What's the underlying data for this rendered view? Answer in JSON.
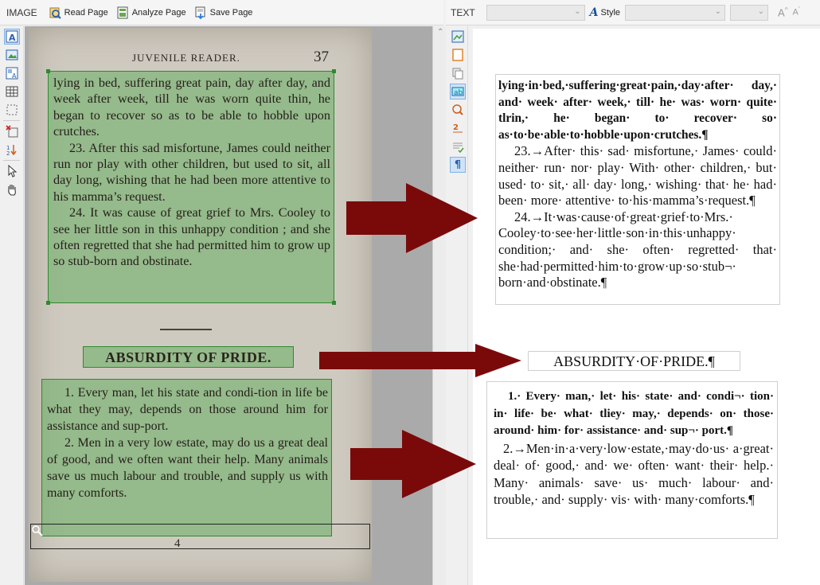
{
  "left_toolbar": {
    "pane_label": "IMAGE",
    "read_page": "Read Page",
    "analyze_page": "Analyze Page",
    "save_page": "Save Page"
  },
  "right_toolbar": {
    "pane_label": "TEXT",
    "style_label": "Style",
    "font_value": "",
    "style_value": "",
    "size_value": "",
    "grow_font": "Aˆ",
    "shrink_font": "Aˇ"
  },
  "scan": {
    "running_head": "JUVENILE READER.",
    "page_number": "37",
    "block1": [
      "lying in bed, suffering great pain, day after day, and week after week, till he was worn quite thin, he began to recover so as to be able to hobble upon crutches.",
      "23. After this sad misfortune, James could neither run nor play with other children, but used to sit, all day long, wishing that he had been more attentive to his mamma’s request.",
      "24. It was cause of great grief to Mrs. Cooley to see her little son in this unhappy condition ; and she often regretted that she had permitted him to grow up so stub-born and obstinate."
    ],
    "title": "ABSURDITY OF PRIDE.",
    "block2": [
      "1. Every man, let his state and condi-tion in life be what they may, depends on those around him for assistance and sup-port.",
      "2. Men in a very low estate, may do us a great deal of good, and we often want their help. Many animals save us much labour and trouble, and supply us with many comforts."
    ],
    "footer": "4"
  },
  "ocr_text": {
    "block1": [
      "lying·in·bed,·suffering·great·pain,·day·after· day,· and· week· after· week,· till· he· was· worn· quite· tlrin,· he· began· to· recover· so· as·to·be·able·to·hobble·upon·crutches.¶",
      "23.→After· this· sad· misfortune,· James· could· neither· run· nor· play· With· other· children,· but· used· to· sit,· all· day· long,· wishing· that· he· had· been· more· attentive· to·his·mamma’s·request.¶",
      "24.→It·was·cause·of·great·grief·to·Mrs.· Cooley·to·see·her·little·son·in·this·unhappy· condition;· and· she· often· regretted· that· she·had·permitted·him·to·grow·up·so·stub¬· born·and·obstinate.¶"
    ],
    "title": "ABSURDITY·OF·PRIDE.¶",
    "block2": [
      "1.· Every· man,· let· his· state· and· condi¬· tion· in· life· be· what· tliey· may,· depends· on· those· around· him· for· assistance· and· sup¬· port.¶",
      "2.→Men·in·a·very·low·estate,·may·do·us· a·great· deal· of· good,· and· we· often· want· their· help.· Many· animals· save· us· much· labour· and· trouble,· and· supply· vis· with· many·comforts.¶"
    ]
  },
  "colors": {
    "zone_fill": "#37a037",
    "arrow": "#7a0a0a",
    "uncertain_highlight": "#9ff0f5",
    "toolbar_bg": "#f5f5f5"
  },
  "icons": {
    "read_page": "read-page-icon",
    "analyze_page": "analyze-page-icon",
    "save_page": "save-page-icon",
    "style": "style-icon"
  }
}
